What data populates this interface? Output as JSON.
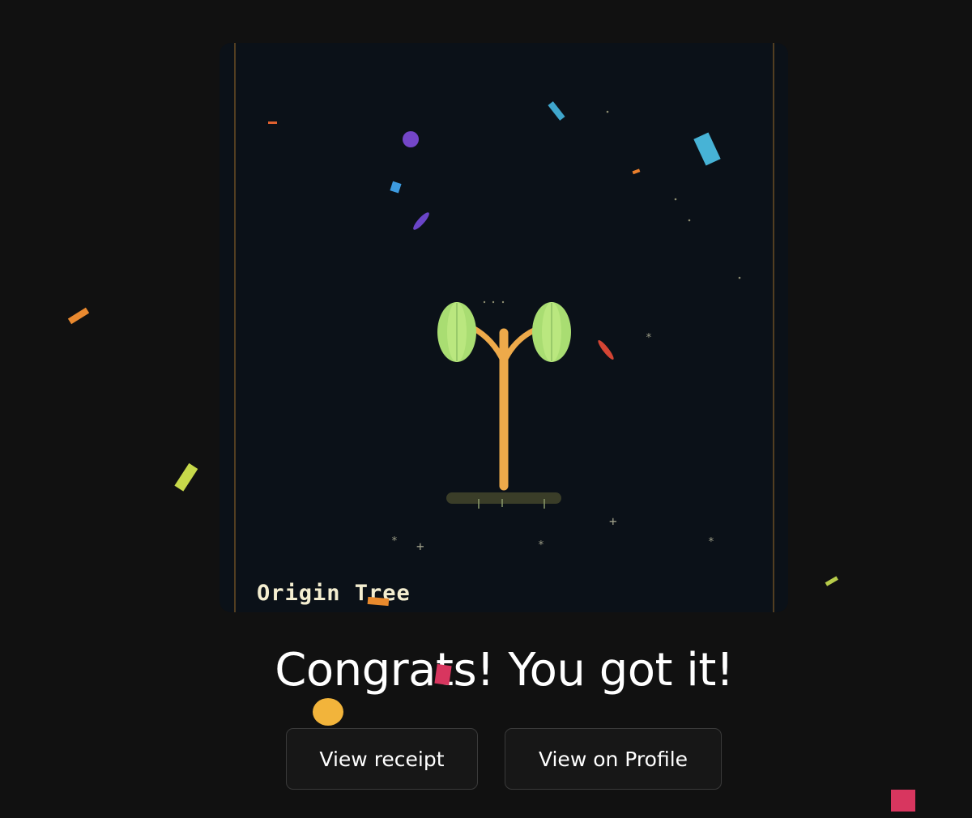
{
  "nft": {
    "title": "Origin Tree",
    "image_icon": "sapling-icon"
  },
  "message": {
    "headline": "Congrats! You got it!"
  },
  "actions": {
    "view_receipt_label": "View receipt",
    "view_profile_label": "View on Profile"
  },
  "colors": {
    "page_background": "#111111",
    "card_background": "#0b1118",
    "tree_trunk": "#eeaa4a",
    "tree_leaf": "#a9dd72",
    "title_text": "#f4eed0",
    "button_background": "#171717",
    "button_border": "#3a3a3a"
  }
}
